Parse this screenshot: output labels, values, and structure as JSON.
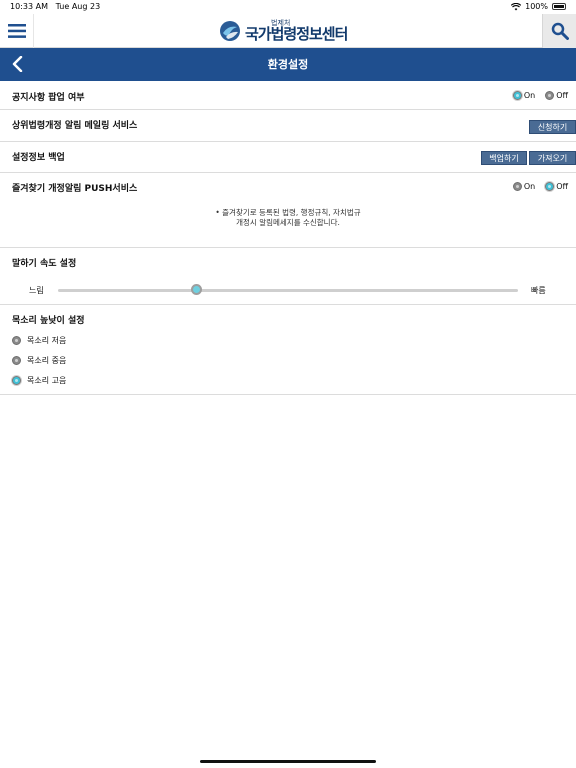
{
  "status_bar": {
    "time": "10:33 AM",
    "date": "Tue Aug 23",
    "battery": "100%"
  },
  "header": {
    "logo_sub": "법제처",
    "logo_main": "국가법령정보센터",
    "menu_icon": "hamburger-icon",
    "search_icon": "search-icon"
  },
  "title_bar": {
    "title": "환경설정",
    "back_icon": "chevron-left-icon"
  },
  "settings": {
    "notice_popup": {
      "label": "공지사항 팝업 여부",
      "on_label": "On",
      "off_label": "Off",
      "selected": "On"
    },
    "mailing": {
      "label": "상위법령개정 알림 메일링 서비스",
      "button": "신청하기"
    },
    "backup": {
      "label": "설정정보 백업",
      "backup_button": "백업하기",
      "restore_button": "가져오기"
    },
    "favorites_push": {
      "label": "즐겨찾기 개정알림 PUSH서비스",
      "on_label": "On",
      "off_label": "Off",
      "selected": "Off",
      "note_line1": "• 즐겨찾기로 등록된 법령, 행정규칙, 자치법규",
      "note_line2": "개정시 알림메세지를 수신합니다."
    },
    "speech_speed": {
      "label": "말하기 속도 설정",
      "min_label": "느림",
      "max_label": "빠름",
      "value": 0.3
    },
    "voice_pitch": {
      "label": "목소리 높낮이 설정",
      "options": [
        "목소리 저음",
        "목소리 중음",
        "목소리 고음"
      ],
      "selected": "목소리 고음"
    }
  },
  "colors": {
    "title_bar": "#1f4f8f",
    "button": "#4a6b94",
    "radio_selected": "#3fc0d6"
  }
}
